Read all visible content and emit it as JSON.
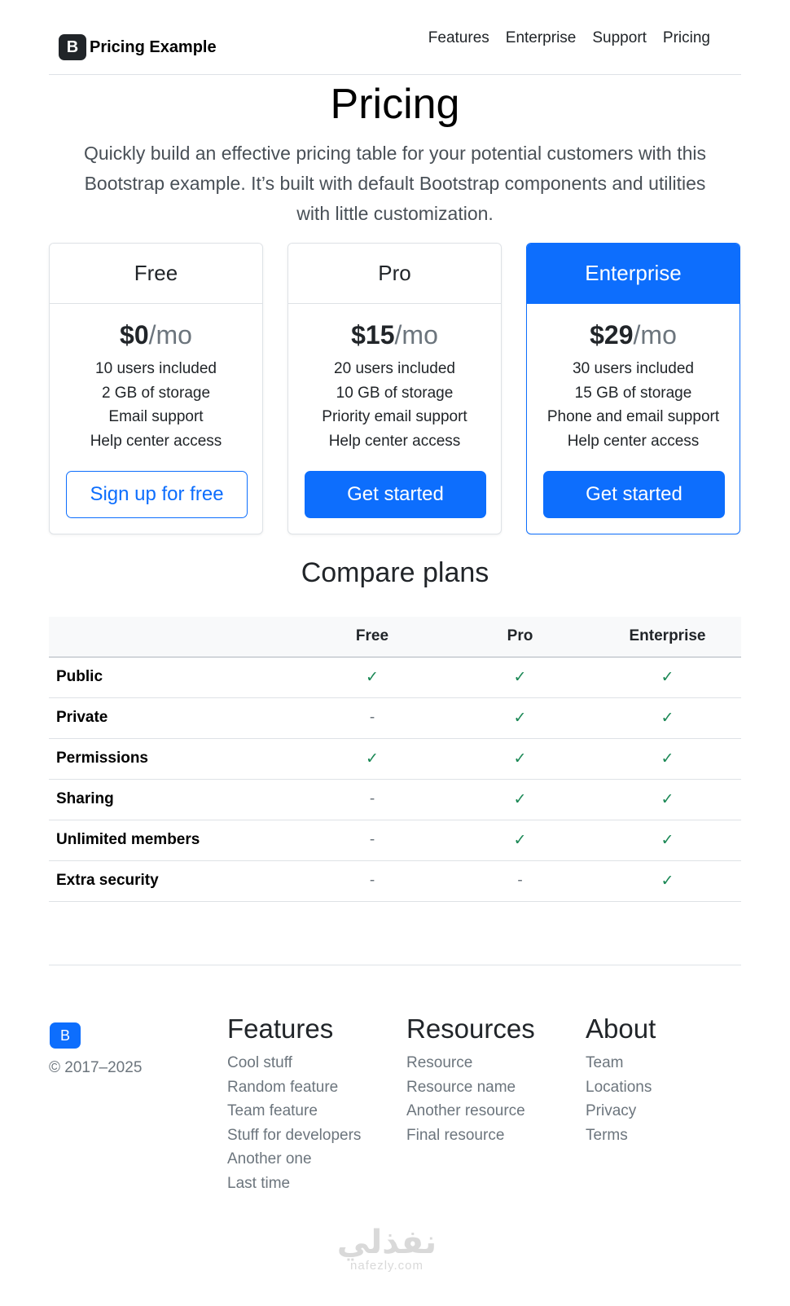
{
  "header": {
    "brand_letter": "B",
    "brand_name": "Pricing Example",
    "nav": [
      "Features",
      "Enterprise",
      "Support",
      "Pricing"
    ]
  },
  "hero": {
    "title": "Pricing",
    "lead": "Quickly build an effective pricing table for your potential customers with this Bootstrap example. It’s built with default Bootstrap components and utilities with little customization."
  },
  "plans": [
    {
      "name": "Free",
      "price": "$0",
      "per": "/mo",
      "features": [
        "10 users included",
        "2 GB of storage",
        "Email support",
        "Help center access"
      ],
      "button": "Sign up for free"
    },
    {
      "name": "Pro",
      "price": "$15",
      "per": "/mo",
      "features": [
        "20 users included",
        "10 GB of storage",
        "Priority email support",
        "Help center access"
      ],
      "button": "Get started"
    },
    {
      "name": "Enterprise",
      "price": "$29",
      "per": "/mo",
      "features": [
        "30 users included",
        "15 GB of storage",
        "Phone and email support",
        "Help center access"
      ],
      "button": "Get started"
    }
  ],
  "compare": {
    "title": "Compare plans",
    "columns": [
      "",
      "Free",
      "Pro",
      "Enterprise"
    ],
    "rows": [
      {
        "label": "Public",
        "cells": [
          "✓",
          "✓",
          "✓"
        ]
      },
      {
        "label": "Private",
        "cells": [
          "-",
          "✓",
          "✓"
        ]
      },
      {
        "label": "Permissions",
        "cells": [
          "✓",
          "✓",
          "✓"
        ]
      },
      {
        "label": "Sharing",
        "cells": [
          "-",
          "✓",
          "✓"
        ]
      },
      {
        "label": "Unlimited members",
        "cells": [
          "-",
          "✓",
          "✓"
        ]
      },
      {
        "label": "Extra security",
        "cells": [
          "-",
          "-",
          "✓"
        ]
      }
    ]
  },
  "footer": {
    "logo_letter": "B",
    "copyright": "© 2017–2025",
    "columns": [
      {
        "title": "Features",
        "links": [
          "Cool stuff",
          "Random feature",
          "Team feature",
          "Stuff for developers",
          "Another one",
          "Last time"
        ]
      },
      {
        "title": "Resources",
        "links": [
          "Resource",
          "Resource name",
          "Another resource",
          "Final resource"
        ]
      },
      {
        "title": "About",
        "links": [
          "Team",
          "Locations",
          "Privacy",
          "Terms"
        ]
      }
    ]
  },
  "watermark": {
    "arabic": "نفذلي",
    "latin": "nafezly.com"
  },
  "colors": {
    "primary": "#0d6efd",
    "check": "#198754",
    "muted": "#6c757d"
  }
}
